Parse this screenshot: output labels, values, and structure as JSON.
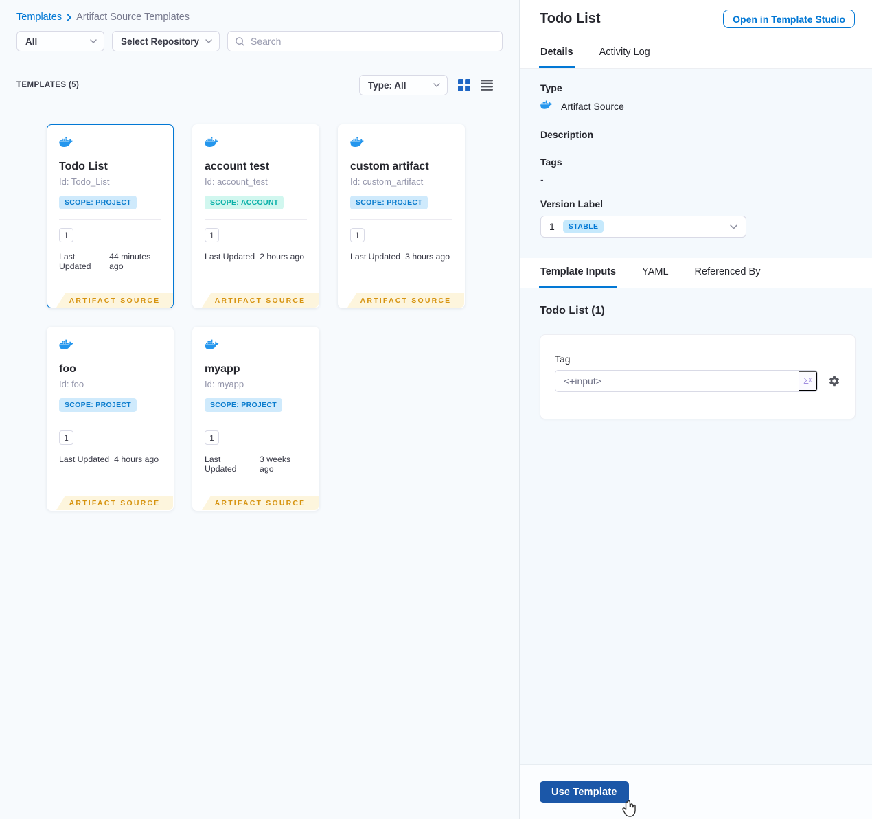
{
  "breadcrumb": {
    "root": "Templates",
    "current": "Artifact Source Templates"
  },
  "filters": {
    "scope_filter": "All",
    "repository_filter": "Select Repository",
    "search_placeholder": "Search"
  },
  "list_header": {
    "count_label": "TEMPLATES (5)",
    "type_filter": "Type: All"
  },
  "cards": [
    {
      "name": "Todo List",
      "id": "Id: Todo_List",
      "scope": "SCOPE: PROJECT",
      "version": "1",
      "updated_label": "Last Updated",
      "updated": "44 minutes ago",
      "footer": "ARTIFACT SOURCE"
    },
    {
      "name": "account test",
      "id": "Id: account_test",
      "scope": "SCOPE: ACCOUNT",
      "version": "1",
      "updated_label": "Last Updated",
      "updated": "2 hours ago",
      "footer": "ARTIFACT SOURCE"
    },
    {
      "name": "custom artifact",
      "id": "Id: custom_artifact",
      "scope": "SCOPE: PROJECT",
      "version": "1",
      "updated_label": "Last Updated",
      "updated": "3 hours ago",
      "footer": "ARTIFACT SOURCE"
    },
    {
      "name": "foo",
      "id": "Id: foo",
      "scope": "SCOPE: PROJECT",
      "version": "1",
      "updated_label": "Last Updated",
      "updated": "4 hours ago",
      "footer": "ARTIFACT SOURCE"
    },
    {
      "name": "myapp",
      "id": "Id: myapp",
      "scope": "SCOPE: PROJECT",
      "version": "1",
      "updated_label": "Last Updated",
      "updated": "3 weeks ago",
      "footer": "ARTIFACT SOURCE"
    }
  ],
  "panel": {
    "title": "Todo List",
    "open_button": "Open in Template Studio",
    "tabs": {
      "details": "Details",
      "activity_log": "Activity Log"
    },
    "details": {
      "type_label": "Type",
      "type_value": "Artifact Source",
      "description_label": "Description",
      "tags_label": "Tags",
      "tags_value": "-",
      "version_label": "Version Label",
      "version_value": "1",
      "version_badge": "STABLE"
    },
    "sub_tabs": {
      "template_inputs": "Template Inputs",
      "yaml": "YAML",
      "referenced_by": "Referenced By"
    },
    "inputs": {
      "heading": "Todo List (1)",
      "tag_label": "Tag",
      "tag_value": "<+input>",
      "expression_symbol": "Σˣ"
    },
    "use_template_button": "Use Template"
  },
  "colors": {
    "accent_blue": "#0278d5",
    "docker_blue": "#2496ed",
    "use_template_blue": "#1b57a8",
    "ribbon_text": "#d69310",
    "ribbon_bg": "#fdf5dd",
    "scope_project_bg": "#cfeafc",
    "scope_account_bg": "#d1f7ef",
    "panel_bg": "#f4f9fd"
  }
}
